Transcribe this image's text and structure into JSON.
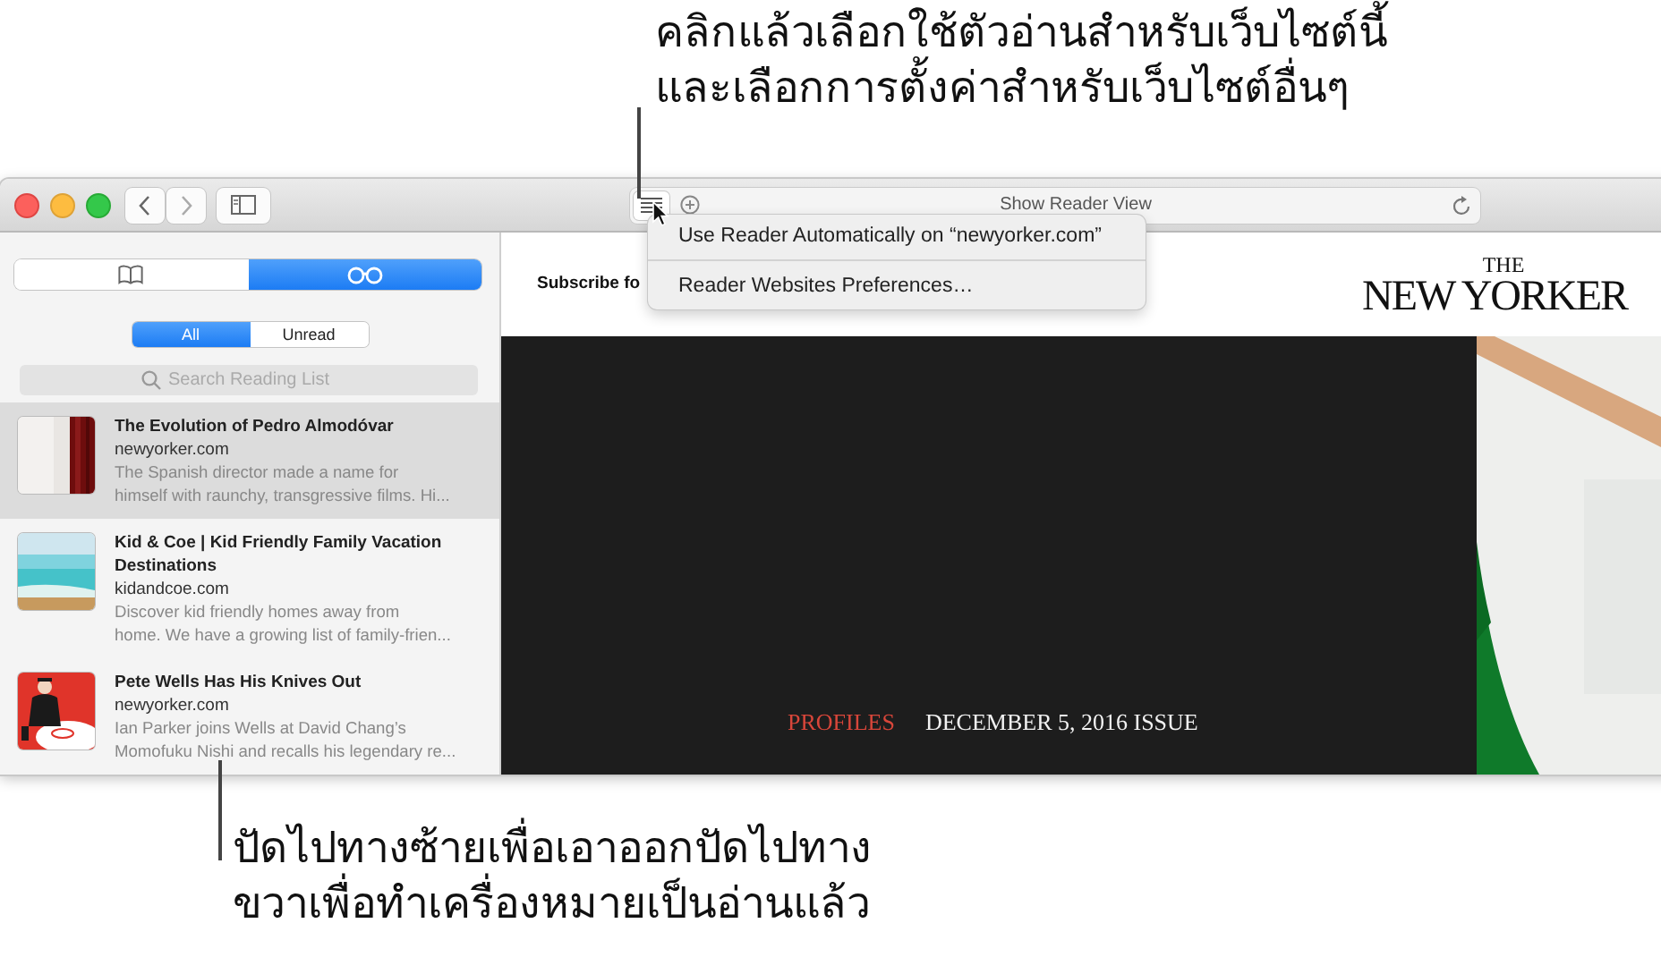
{
  "top_callout": {
    "lines": [
      "คลิกแล้วเลือกใช้ตัวอ่านสำหรับเว็บไซต์นี้",
      "และเลือกการตั้งค่าสำหรับเว็บไซต์อื่นๆ"
    ]
  },
  "toolbar": {
    "address_text": "Show Reader View"
  },
  "reader_menu": {
    "items": [
      "Use Reader Automatically on “newyorker.com”",
      "Reader Websites Preferences…"
    ]
  },
  "sidebar": {
    "tabs": [
      {
        "kind": "bookmarks",
        "selected": false
      },
      {
        "kind": "reading-list",
        "selected": true
      }
    ],
    "filters": [
      {
        "label": "All",
        "selected": true
      },
      {
        "label": "Unread",
        "selected": false
      }
    ],
    "search": {
      "placeholder": "Search Reading List"
    },
    "items": [
      {
        "title": "The Evolution of Pedro Almodóvar",
        "site": "newyorker.com",
        "summary_lines": [
          "The Spanish director made a name for",
          "himself with raunchy, transgressive films. Hi..."
        ],
        "selected": true
      },
      {
        "title": "Kid & Coe | Kid Friendly Family Vacation Destinations",
        "site": "kidandcoe.com",
        "summary_lines": [
          "Discover kid friendly homes away from",
          "home. We have a growing list of family-frien..."
        ],
        "selected": false
      },
      {
        "title": "Pete Wells Has His Knives Out",
        "site": "newyorker.com",
        "summary_lines": [
          "Ian Parker joins Wells at David Chang’s",
          "Momofuku Nishi and recalls his legendary re..."
        ],
        "selected": false
      }
    ]
  },
  "page": {
    "subscribe_text": "Subscribe fo",
    "logo_lines": [
      "THE",
      "NEW YORKER"
    ],
    "rubric": "PROFILES",
    "issue": "DECEMBER 5, 2016 ISSUE"
  },
  "bottom_callout": {
    "lines": [
      "ปัดไปทางซ้ายเพื่อเอาออกปัดไปทาง",
      "ขวาเพื่อทำเครื่องหมายเป็นอ่านแล้ว"
    ]
  }
}
